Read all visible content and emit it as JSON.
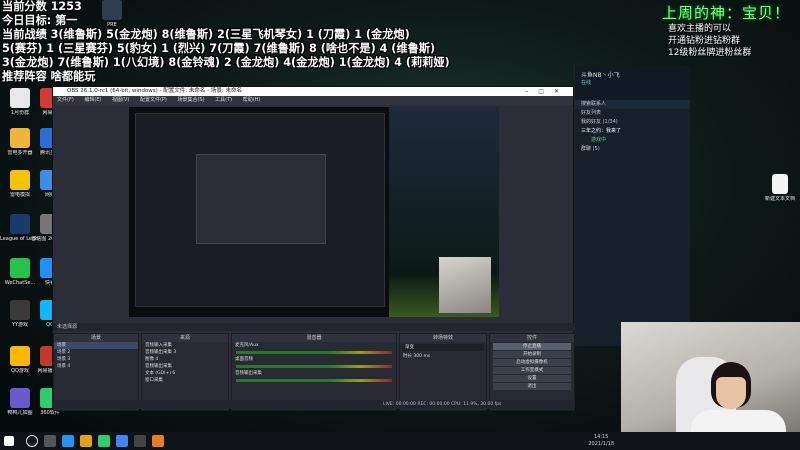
{
  "overlay_left": {
    "score_line": "当前分数 1253",
    "goal_line": "今日目标: 第一",
    "record_lines": [
      "当前战绩 3(维鲁斯) 5(金龙炮) 8(维鲁斯) 2(三星飞机琴女) 1 (刀霞) 1 (金龙炮)",
      "5(赛芬) 1 (三星赛芬) 5(豹女) 1 (烈兴) 7(刀霞) 7(维鲁斯) 8 (啥也不是) 4 (维鲁斯)",
      "3(金龙炮) 7(维鲁斯) 1(八幻境) 8(金铃魂) 2 (金龙炮) 4(金龙炮) 1(金龙炮) 4 (莉莉娅)"
    ],
    "recommend_line": "推荐阵容 啥都能玩"
  },
  "overlay_right": {
    "title": "上周的神：宝贝！",
    "lines": [
      "喜欢主播的可以",
      "开通钻粉进钻粉群",
      "12级粉丝牌进粉丝群"
    ]
  },
  "desktop_icons": [
    {
      "label": "1月份群",
      "color": "#e8e8e8"
    },
    {
      "label": "雷电多开器",
      "color": "#f2b53a"
    },
    {
      "label": "雷电模拟",
      "color": "#f5c400"
    },
    {
      "label": "League of Legends",
      "color": "#1a3a6a"
    },
    {
      "label": "WeChatSe...",
      "color": "#27c24c"
    },
    {
      "label": "YY游戏",
      "color": "#3a3a3a"
    },
    {
      "label": "QQ游戏",
      "color": "#ffb800"
    },
    {
      "label": "鸭鸭儿如图",
      "color": "#6a5acd"
    },
    {
      "label": "网易云",
      "color": "#d33a31"
    },
    {
      "label": "腾讯多多",
      "color": "#2a6fd6"
    },
    {
      "label": "网络",
      "color": "#3a8ee6"
    },
    {
      "label": "微信图 20220...",
      "color": "#777"
    },
    {
      "label": "快看",
      "color": "#1e90ff"
    },
    {
      "label": "QQ",
      "color": "#12b7f5"
    },
    {
      "label": "网易播放器",
      "color": "#c0392b"
    },
    {
      "label": "360软件",
      "color": "#2ecc71"
    },
    {
      "label": "PRE",
      "color": "#2c3e50"
    }
  ],
  "obs": {
    "title": "OBS 26.1.0-rc1 (64-bit, windows) - 配置文件: 未命名 - 场景: 未命名",
    "menu": [
      "文件(F)",
      "编辑(E)",
      "视图(V)",
      "配置文件(P)",
      "场景集合(S)",
      "工具(T)",
      "帮助(H)"
    ],
    "scene_bar": "未选择源",
    "docks": {
      "scenes": {
        "header": "场景",
        "items": [
          "场景",
          "场景 2",
          "场景 3",
          "场景 4"
        ]
      },
      "sources": {
        "header": "来源",
        "items": [
          "音频输入采集",
          "音频输出采集 3",
          "图像 4",
          "音频输出采集",
          "文本 (GDI+) 6",
          "窗口采集"
        ]
      },
      "mixer": {
        "header": "混音器",
        "items": [
          "麦克风/Aux",
          "桌面音频",
          "音频输出采集"
        ]
      },
      "transitions": {
        "header": "转场特效",
        "items": [
          "渐变",
          "时长  300 ms"
        ]
      },
      "controls": {
        "header": "控件",
        "buttons": [
          "停止直播",
          "开始录制",
          "启动虚拟摄像机",
          "工作室模式",
          "设置",
          "退出"
        ]
      }
    },
    "status": "LIVE: 00:00:00   REC: 00:00:00   CPU: 11.9%, 30.00 fps"
  },
  "qq_panel": {
    "name": "斗鱼NB丶小飞",
    "status": "在线",
    "search": "搜索联系人",
    "sections": [
      "好友列表",
      "我的好友 (1/34)",
      "群聊 (5)"
    ],
    "contact": "三年之约：我来了",
    "contact_status": "游戏中"
  },
  "desktop_right_icon": {
    "label": "新建文本文档"
  },
  "taskbar": {
    "time": "14:15",
    "date": "2021/1/18"
  }
}
